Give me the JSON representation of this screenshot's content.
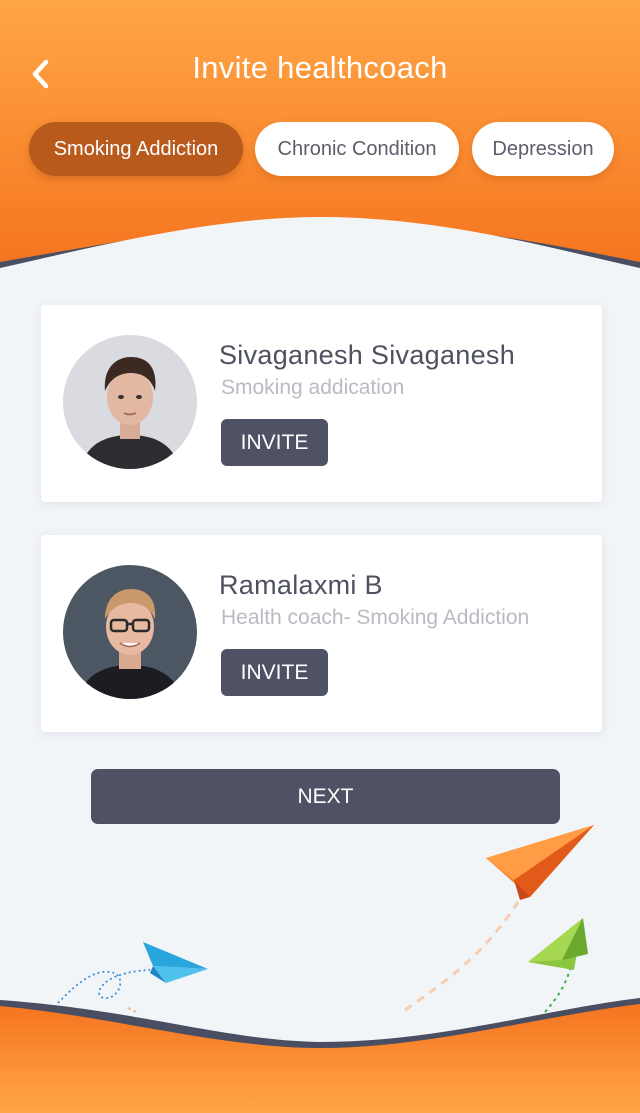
{
  "header": {
    "title": "Invite healthcoach",
    "back_icon": "chevron-left-icon",
    "tabs": [
      {
        "label": "Smoking Addiction",
        "active": true
      },
      {
        "label": "Chronic Condition",
        "active": false
      },
      {
        "label": "Depression",
        "active": false
      }
    ]
  },
  "coaches": [
    {
      "name": "Sivaganesh Sivaganesh",
      "role": "Smoking addication",
      "button": "INVITE"
    },
    {
      "name": "Ramalaxmi B",
      "role": "Health coach- Smoking Addiction",
      "button": "INVITE"
    }
  ],
  "actions": {
    "next_label": "NEXT"
  },
  "colors": {
    "header_gradient_top": "#ffa646",
    "header_gradient_bottom": "#f5741f",
    "active_tab": "#b85a1c",
    "button": "#4f5264",
    "wave_dark": "#4a4e63"
  }
}
